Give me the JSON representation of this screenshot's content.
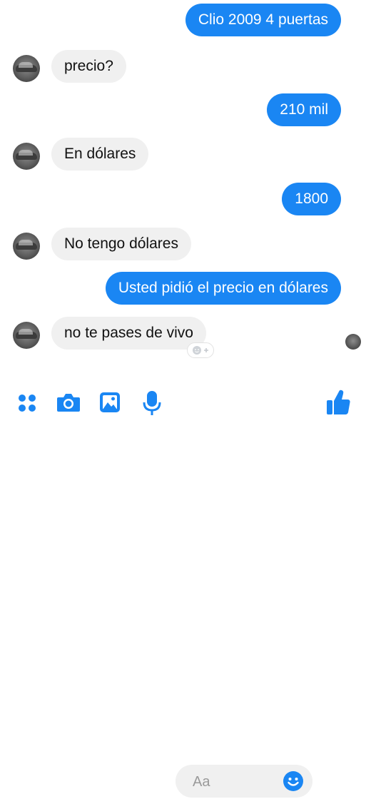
{
  "messages": [
    {
      "side": "out",
      "text": "Clio 2009 4 puertas"
    },
    {
      "side": "in",
      "text": "precio?"
    },
    {
      "side": "out",
      "text": "210 mil"
    },
    {
      "side": "in",
      "text": "En dólares"
    },
    {
      "side": "out",
      "text": "1800"
    },
    {
      "side": "in",
      "text": "No tengo dólares"
    },
    {
      "side": "out",
      "text": "Usted pidió el precio en dólares"
    },
    {
      "side": "in",
      "text": "no te pases de vivo"
    }
  ],
  "composer": {
    "placeholder": "Aa"
  },
  "toolbar": {
    "icons": [
      "more-apps-icon",
      "camera-icon",
      "gallery-icon",
      "microphone-icon",
      "emoji-icon",
      "thumbs-up-icon"
    ]
  },
  "colors": {
    "accent": "#1a86f3",
    "incoming_bubble": "#f0f0f0"
  }
}
